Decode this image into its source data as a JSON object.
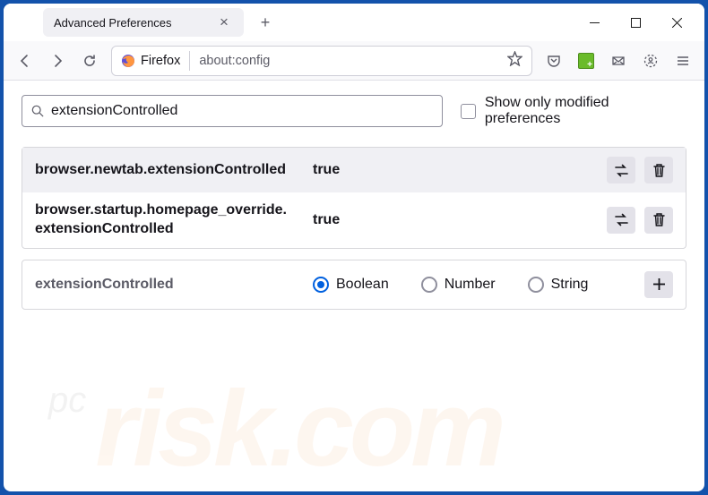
{
  "tab": {
    "title": "Advanced Preferences"
  },
  "urlbar": {
    "identity": "Firefox",
    "url": "about:config"
  },
  "search": {
    "value": "extensionControlled",
    "filter_label": "Show only modified preferences"
  },
  "prefs": [
    {
      "name": "browser.newtab.extensionControlled",
      "value": "true"
    },
    {
      "name": "browser.startup.homepage_override.\nextensionControlled",
      "value": "true"
    }
  ],
  "add": {
    "name": "extensionControlled",
    "types": {
      "boolean": "Boolean",
      "number": "Number",
      "string": "String"
    }
  },
  "watermark": {
    "prefix": "pc",
    "main": "risk.com"
  }
}
